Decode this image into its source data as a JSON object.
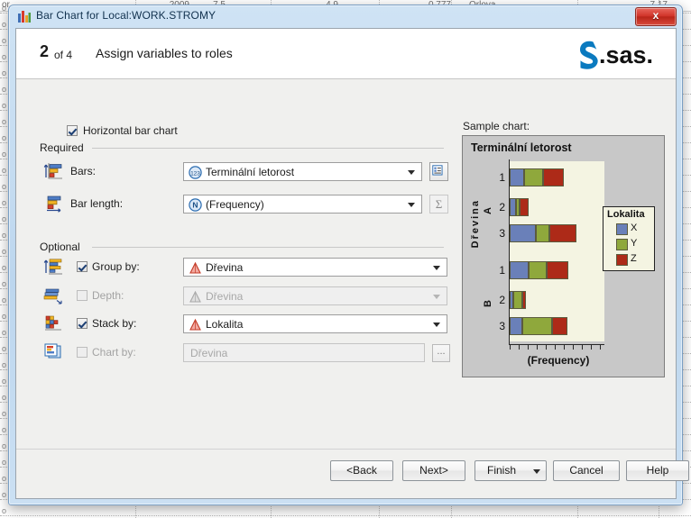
{
  "background": {
    "row_cells": [
      "or",
      "2009",
      "7.5",
      "4.9",
      "0.777",
      "Orlova",
      "7.17"
    ],
    "row_marker": "o"
  },
  "window": {
    "title": "Bar Chart for Local:WORK.STROMY",
    "title_icon": "bar-chart-icon",
    "close_label": "x"
  },
  "header": {
    "step_number": "2",
    "step_of": "of 4",
    "step_title": "Assign variables to roles",
    "logo_text": "sas"
  },
  "options": {
    "horizontal_bar_chart": {
      "label": "Horizontal bar chart",
      "checked": true
    }
  },
  "groups": {
    "required_label": "Required",
    "optional_label": "Optional"
  },
  "fields": {
    "bars": {
      "label": "Bars:",
      "value": "Terminální letorost",
      "value_icon": "numeric-variable-icon",
      "side_button": "variable-properties-icon"
    },
    "bar_length": {
      "label": "Bar length:",
      "value": "(Frequency)",
      "value_icon": "n-variable-icon",
      "side_button": "sigma-icon",
      "side_button_glyph": "Σ"
    },
    "group_by": {
      "label": "Group by:",
      "value": "Dřevina",
      "value_icon": "category-variable-icon",
      "checked": true,
      "enabled": true
    },
    "depth": {
      "label": "Depth:",
      "value": "Dřevina",
      "value_icon": "category-variable-icon-disabled",
      "checked": false,
      "enabled": false
    },
    "stack_by": {
      "label": "Stack by:",
      "value": "Lokalita",
      "value_icon": "category-variable-icon",
      "checked": true,
      "enabled": true
    },
    "chart_by": {
      "label": "Chart by:",
      "value": "Dřevina",
      "checked": false,
      "enabled": false,
      "side_button": "ellipsis-button",
      "side_button_glyph": "..."
    }
  },
  "sample": {
    "label": "Sample chart:"
  },
  "chart_data": {
    "type": "bar",
    "orientation": "horizontal",
    "stacked": true,
    "title": "Terminální letorost",
    "xlabel": "(Frequency)",
    "ylabel": "Dřevina",
    "grid": false,
    "legend": {
      "title": "Lokalita",
      "position": "right-inside",
      "entries": [
        {
          "name": "X",
          "color": "#6a80b9"
        },
        {
          "name": "Y",
          "color": "#8fa83c"
        },
        {
          "name": "Z",
          "color": "#ad2a18"
        }
      ]
    },
    "group_labels": [
      "A",
      "B"
    ],
    "categories": [
      "1",
      "2",
      "3",
      "1",
      "2",
      "3"
    ],
    "category_groups": [
      "A",
      "A",
      "A",
      "B",
      "B",
      "B"
    ],
    "series": [
      {
        "name": "X",
        "color": "#6a80b9",
        "values": [
          16,
          7,
          29,
          21,
          4,
          14
        ]
      },
      {
        "name": "Y",
        "color": "#8fa83c",
        "values": [
          21,
          4,
          15,
          20,
          10,
          33
        ]
      },
      {
        "name": "Z",
        "color": "#ad2a18",
        "values": [
          23,
          10,
          30,
          24,
          4,
          17
        ]
      }
    ],
    "xlim": [
      0,
      105
    ],
    "xticks": [
      0,
      10,
      20,
      30,
      40,
      50,
      60,
      70,
      80,
      90,
      100
    ]
  },
  "footer": {
    "buttons": [
      {
        "name": "back",
        "label": "<Back"
      },
      {
        "name": "next",
        "label": "Next>"
      },
      {
        "name": "finish",
        "label": "Finish"
      },
      {
        "name": "cancel",
        "label": "Cancel"
      },
      {
        "name": "help",
        "label": "Help"
      }
    ]
  }
}
